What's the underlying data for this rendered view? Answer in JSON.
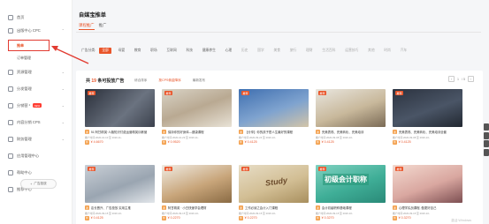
{
  "sidebar": {
    "items": [
      {
        "label": "首页"
      },
      {
        "label": "出版中心 CPC"
      },
      {
        "label": "资源管理"
      },
      {
        "label": "分发管理"
      },
      {
        "label": "分销营 ²",
        "badge": "NEW"
      },
      {
        "label": "内容分销 CPS"
      },
      {
        "label": "财务管理"
      },
      {
        "label": "应用管理中心"
      },
      {
        "label": "帮助中心"
      },
      {
        "label": "推荐中心"
      }
    ],
    "subitems": [
      {
        "label": "推单",
        "active": true
      },
      {
        "label": "订单管理",
        "active": false
      }
    ],
    "bottom_button": "广告投放"
  },
  "page": {
    "title": "自媒宝推单",
    "tabs": [
      "课程推广",
      "推广"
    ],
    "filter_label": "广告分类:",
    "filters": [
      "全部",
      "母婴",
      "教育",
      "职场",
      "互联网",
      "科技",
      "健康养生",
      "心理",
      "历史",
      "国学",
      "美食",
      "旅行",
      "理财",
      "生活百科",
      "运营技巧",
      "其他",
      "时尚",
      "汽车",
      "体育",
      "科技"
    ]
  },
  "section": {
    "prefix": "共",
    "count": "19",
    "suffix": "条可投放广告",
    "sort": [
      "综合排序",
      "按CPS佣金降序",
      "最新发布"
    ],
    "page": "1",
    "pages": "/ 5"
  },
  "courses": [
    {
      "tag": "推荐",
      "title": "51 阿甘精英·人脑知识付费运营精英训练营",
      "meta": "推广时间:2020-10-10 至 2020-11-",
      "price": "¥ 4.6670"
    },
    {
      "tag": "推荐",
      "title": "保持你的好身体—健康课程",
      "meta": "推广时间:2020-10-29 至 2020-11-",
      "price": "¥ 0.9520"
    },
    {
      "tag": "推荐",
      "title": "【分享】你的孩子是人生最好的课程",
      "meta": "推广时间:2020-09-24 至 2020-10-",
      "price": "¥ 0.4125"
    },
    {
      "tag": "推荐",
      "title": "完美表现、完美转化、完美培训",
      "meta": "推广时间:2020-09-08 至 2020-10-",
      "price": "¥ 0.4125"
    },
    {
      "tag": "推荐",
      "title": "完美表现、完美转化、完美培训全套",
      "meta": "推广时间:2020-09-08 至 2020-10-",
      "price": "¥ 0.4125"
    },
    {
      "tag": "推荐",
      "title": "店长晋升、广告投放 实用主推",
      "meta": "推广时间:2020-09-15 至 2020-10-",
      "price": "¥ 0.4125"
    },
    {
      "tag": "推荐",
      "title": "阿甘精英 · 小白快速学会理财",
      "meta": "推广时间:2020-09-15 至 2020-10-",
      "price": "¥ 0.2270"
    },
    {
      "tag": "推荐",
      "title": "工作必读之会计入门课程",
      "meta": "推广时间:2020-09-15 至 2020-10-",
      "price": "¥ 0.2270",
      "study": "Study"
    },
    {
      "tag": "推荐",
      "title": "会计初级职称基础课程",
      "meta": "推广时间:2020-09-15 至 2020-10-",
      "price": "¥ 0.3270",
      "study": "初级会计职称"
    },
    {
      "tag": "推荐",
      "title": "心理学实战课程, 做更好自己",
      "meta": "推广时间:2020-09-15 至 2020-10-",
      "price": "¥ 0.3270"
    }
  ],
  "watermark": "激活 Windows",
  "colors": {
    "accent": "#e9552a",
    "annotation": "#e23b31"
  },
  "icons": [
    "home-icon",
    "book-icon",
    "folder-icon",
    "share-icon",
    "chart-icon",
    "layers-icon",
    "wallet-icon",
    "apps-icon",
    "help-icon",
    "star-icon"
  ]
}
